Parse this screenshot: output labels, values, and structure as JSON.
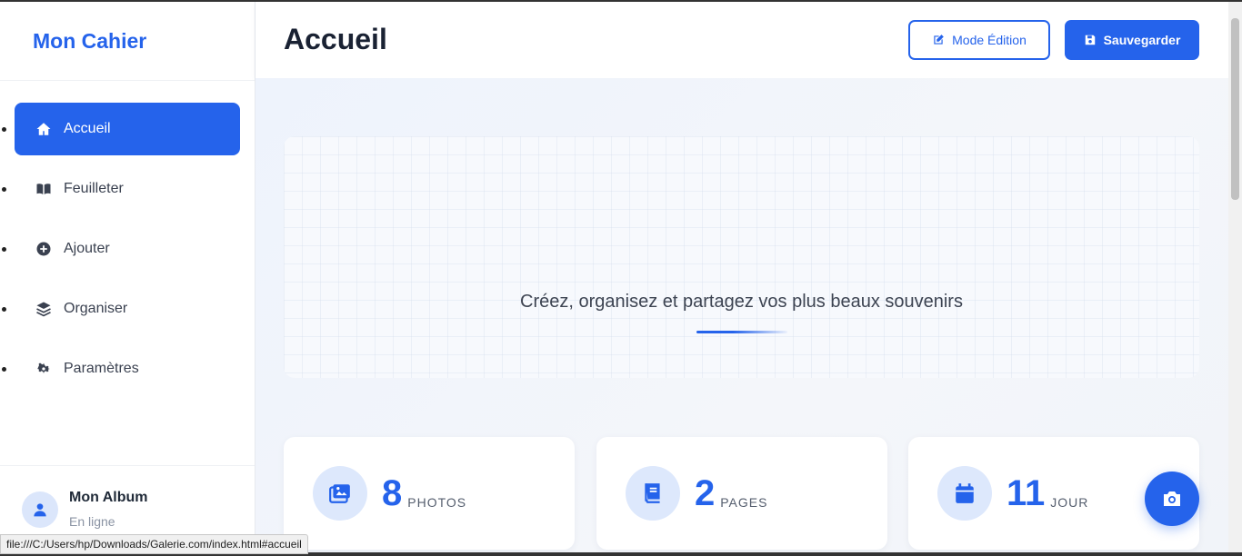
{
  "brand": "Mon Cahier",
  "nav": [
    {
      "label": "Accueil",
      "icon": "home-icon",
      "active": true
    },
    {
      "label": "Feuilleter",
      "icon": "book-open-icon"
    },
    {
      "label": "Ajouter",
      "icon": "plus-circle-icon"
    },
    {
      "label": "Organiser",
      "icon": "layers-icon"
    },
    {
      "label": "Paramètres",
      "icon": "gear-icon"
    }
  ],
  "user": {
    "name": "Mon Album",
    "status": "En ligne"
  },
  "header": {
    "title": "Accueil",
    "edit_label": "Mode Édition",
    "save_label": "Sauvegarder"
  },
  "hero": {
    "tagline": "Créez, organisez et partagez vos plus beaux souvenirs"
  },
  "stats": [
    {
      "value": "8",
      "label": "PHOTOS",
      "icon": "images-icon"
    },
    {
      "value": "2",
      "label": "PAGES",
      "icon": "book-icon"
    },
    {
      "value": "11",
      "label": "JOUR",
      "icon": "calendar-icon"
    }
  ],
  "fab_icon": "camera-icon",
  "status_url": "file:///C:/Users/hp/Downloads/Galerie.com/index.html#accueil",
  "colors": {
    "accent": "#2563eb"
  }
}
